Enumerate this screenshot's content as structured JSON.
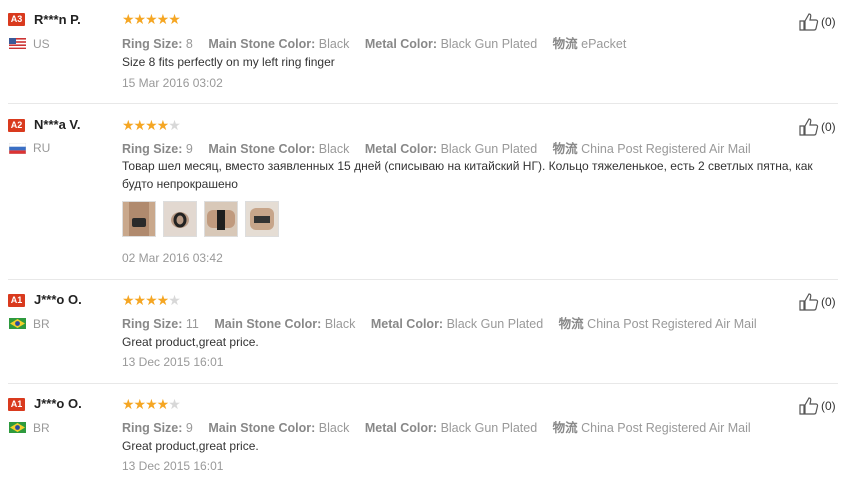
{
  "reviews": [
    {
      "level": "A3",
      "name": "R***n P.",
      "country": "US",
      "rating": 5,
      "ring_size_label": "Ring Size:",
      "ring_size": "8",
      "stone_label": "Main Stone Color:",
      "stone": "Black",
      "metal_label": "Metal Color:",
      "metal": "Black Gun Plated",
      "logistics_label": "物流",
      "logistics": "ePacket",
      "text": "Size 8 fits perfectly on my left ring finger",
      "date": "15 Mar 2016 03:02",
      "likes": "(0)"
    },
    {
      "level": "A2",
      "name": "N***a V.",
      "country": "RU",
      "rating": 4,
      "ring_size_label": "Ring Size:",
      "ring_size": "9",
      "stone_label": "Main Stone Color:",
      "stone": "Black",
      "metal_label": "Metal Color:",
      "metal": "Black Gun Plated",
      "logistics_label": "物流",
      "logistics": "China Post Registered Air Mail",
      "text": "Товар шел месяц, вместо заявленных 15 дней (списываю на китайский НГ). Кольцо тяжеленькое, есть 2 светлых пятна, как будто непрокрашено",
      "date": "02 Mar 2016 03:42",
      "likes": "(0)"
    },
    {
      "level": "A1",
      "name": "J***o O.",
      "country": "BR",
      "rating": 4,
      "ring_size_label": "Ring Size:",
      "ring_size": "11",
      "stone_label": "Main Stone Color:",
      "stone": "Black",
      "metal_label": "Metal Color:",
      "metal": "Black Gun Plated",
      "logistics_label": "物流",
      "logistics": "China Post Registered Air Mail",
      "text": "Great product,great price.",
      "date": "13 Dec 2015 16:01",
      "likes": "(0)"
    },
    {
      "level": "A1",
      "name": "J***o O.",
      "country": "BR",
      "rating": 4,
      "ring_size_label": "Ring Size:",
      "ring_size": "9",
      "stone_label": "Main Stone Color:",
      "stone": "Black",
      "metal_label": "Metal Color:",
      "metal": "Black Gun Plated",
      "logistics_label": "物流",
      "logistics": "China Post Registered Air Mail",
      "text": "Great product,great price.",
      "date": "13 Dec 2015 16:01",
      "likes": "(0)"
    }
  ],
  "colors": {
    "badge": "#d93a1e",
    "star": "#f5a623",
    "star_off": "#d8d8d8"
  }
}
